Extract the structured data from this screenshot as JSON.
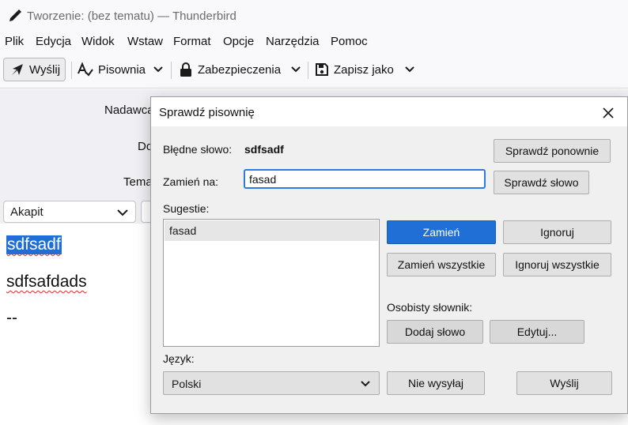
{
  "window": {
    "title": "Tworzenie: (bez tematu) — Thunderbird"
  },
  "menubar": {
    "items": [
      "Plik",
      "Edycja",
      "Widok",
      "Wstaw",
      "Format",
      "Opcje",
      "Narzędzia",
      "Pomoc"
    ]
  },
  "toolbar": {
    "send_label": "Wyślij",
    "spelling_label": "Pisownia",
    "security_label": "Zabezpieczenia",
    "save_as_label": "Zapisz jako"
  },
  "compose_header": {
    "from_label": "Nadawca",
    "to_label": "Do",
    "subject_label": "Temat"
  },
  "format_bar": {
    "paragraph_value": "Akapit"
  },
  "message_body": {
    "lines": [
      "sdfsadf",
      "sdfsafdads",
      "--"
    ]
  },
  "spell_dialog": {
    "title": "Sprawdź pisownię",
    "misspelled_label": "Błędne słowo:",
    "misspelled_word": "sdfsadf",
    "replace_label": "Zamień na:",
    "replace_value": "fasad",
    "suggestions_label": "Sugestie:",
    "suggestions": [
      "fasad"
    ],
    "buttons": {
      "recheck": "Sprawdź ponownie",
      "check_word": "Sprawdź słowo",
      "replace": "Zamień",
      "ignore": "Ignoruj",
      "replace_all": "Zamień wszystkie",
      "ignore_all": "Ignoruj wszystkie",
      "add_word": "Dodaj słowo",
      "edit": "Edytuj...",
      "dont_send": "Nie wysyłaj",
      "send": "Wyślij"
    },
    "personal_dictionary_label": "Osobisty słownik:",
    "language_label": "Język:",
    "language_value": "Polski"
  },
  "colors": {
    "accent": "#1f6fd6",
    "misspelling_underline": "#e02a2a"
  }
}
